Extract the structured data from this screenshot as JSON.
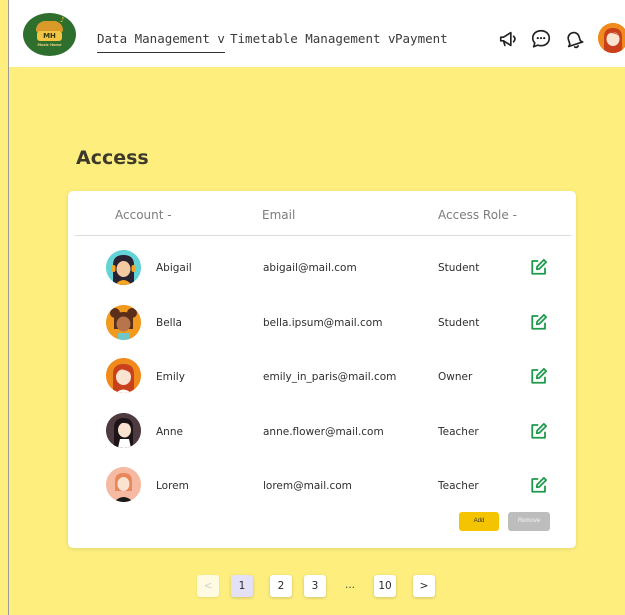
{
  "brand": {
    "logo_text": "MH",
    "logo_subtitle": "Music Home"
  },
  "nav": {
    "links": [
      {
        "label": "Data Management v"
      },
      {
        "label": "Timetable Management v"
      },
      {
        "label": "Payment"
      }
    ],
    "icons": [
      "megaphone-icon",
      "chat-bubble-icon",
      "bell-icon",
      "user-avatar"
    ]
  },
  "page": {
    "title": "Access"
  },
  "table": {
    "headers": {
      "account": "Account -",
      "email": "Email",
      "role": "Access Role -"
    },
    "rows": [
      {
        "name": "Abigail",
        "email": "abigail@mail.com",
        "role": "Student",
        "avatar": "teal-girl-with-headphones"
      },
      {
        "name": "Bella",
        "email": "bella.ipsum@mail.com",
        "role": "Student",
        "avatar": "orange-girl-with-buns"
      },
      {
        "name": "Emily",
        "email": "emily_in_paris@mail.com",
        "role": "Owner",
        "avatar": "orange-girl-red-hair"
      },
      {
        "name": "Anne",
        "email": "anne.flower@mail.com",
        "role": "Teacher",
        "avatar": "dark-woman-long-hair"
      },
      {
        "name": "Lorem",
        "email": "lorem@mail.com",
        "role": "Teacher",
        "avatar": "peach-woman-bob"
      }
    ]
  },
  "actions": {
    "add_label": "Add",
    "remove_label": "Remove"
  },
  "pagination": {
    "prev": "<",
    "pages": [
      "1",
      "2",
      "3"
    ],
    "ellipsis": "...",
    "last": "10",
    "next": ">",
    "current": "1"
  },
  "colors": {
    "background": "#fdee7e",
    "accent_yellow": "#f5c400",
    "edit_green": "#1f9a4c",
    "remove_gray": "#bdbdbd",
    "current_page": "#e4e0f6"
  }
}
